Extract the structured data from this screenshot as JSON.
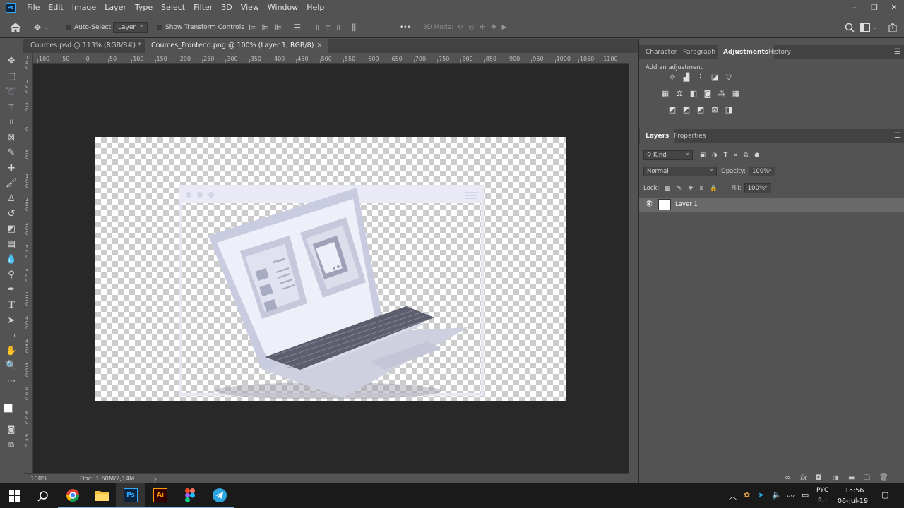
{
  "app": {
    "logo": "Ps",
    "menu": [
      "File",
      "Edit",
      "Image",
      "Layer",
      "Type",
      "Select",
      "Filter",
      "3D",
      "View",
      "Window",
      "Help"
    ],
    "window_controls": [
      "–",
      "❐",
      "✕"
    ]
  },
  "options_bar": {
    "auto_select_label": "Auto-Select:",
    "auto_select_value": "Layer",
    "show_transform_label": "Show Transform Controls",
    "more_label": "•••",
    "mode_3d_label": "3D Mode:"
  },
  "tabs": [
    {
      "label": "Cources.psd @ 113% (RGB/8#) *",
      "close": "✕",
      "active": false
    },
    {
      "label": "Cources_Frontend.png @ 100% (Layer 1, RGB/8)",
      "close": "✕",
      "active": true
    }
  ],
  "ruler": {
    "top_ticks": [
      "100",
      "50",
      "0",
      "50",
      "100",
      "150",
      "200",
      "250",
      "300",
      "350",
      "400",
      "450",
      "500",
      "550",
      "600",
      "650",
      "700",
      "750",
      "800",
      "850",
      "900",
      "950",
      "1000",
      "1050",
      "1100"
    ],
    "left_ticks": [
      "1\n5\n0",
      "1\n0\n0",
      "5\n0",
      "0",
      "5\n0",
      "1\n0\n0",
      "1\n5\n0",
      "2\n0\n0",
      "2\n5\n0",
      "3\n0\n0",
      "3\n5\n0",
      "4\n0\n0",
      "4\n5\n0",
      "5\n0\n0",
      "5\n5\n0",
      "6\n0\n0",
      "6\n5\n0"
    ]
  },
  "status": {
    "zoom": "100%",
    "doc": "Doc: 1,60M/2,14M",
    "arrow": "〉"
  },
  "right_panels": {
    "top_tabs": [
      "Character",
      "Paragraph",
      "Adjustments",
      "History"
    ],
    "active_top_tab": "Adjustments",
    "add_adjustment_label": "Add an adjustment",
    "layers_tabs": [
      "Layers",
      "Properties"
    ],
    "kind_label": "Kind",
    "blend_mode": "Normal",
    "opacity_label": "Opacity:",
    "opacity_value": "100%",
    "lock_label": "Lock:",
    "fill_label": "Fill:",
    "fill_value": "100%",
    "layer_name": "Layer 1",
    "bottom_icons": [
      "∞",
      "fx",
      "◘",
      "◑",
      "▬",
      "❏",
      "🗑"
    ]
  },
  "taskbar": {
    "lang_top": "РУС",
    "lang_bottom": "RU",
    "time": "15:56",
    "date": "06-Jul-19",
    "ai_label": "Ai",
    "ps_label": "Ps"
  },
  "colors": {
    "panel_bg": "#535353",
    "workspace_bg": "#282828",
    "photoshop_blue": "#31a8ff",
    "illustrator_orange": "#ff9a00",
    "taskbar_bg": "#1a1a1a",
    "mockup_lavender": "#c9cbe0"
  }
}
